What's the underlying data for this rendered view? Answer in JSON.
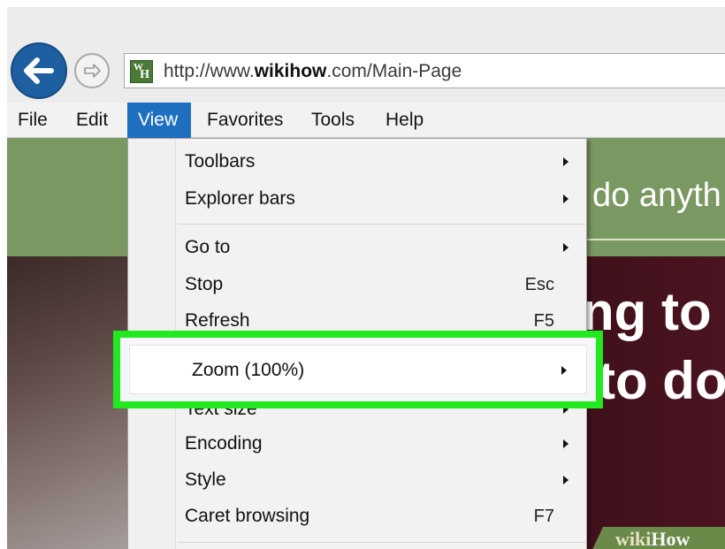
{
  "browser": {
    "url_prefix": "http://www.",
    "url_domain": "wikihow",
    "url_suffix": ".com/Main-Page",
    "favicon_w": "W",
    "favicon_h": "H"
  },
  "menubar": {
    "items": [
      {
        "label": "File"
      },
      {
        "label": "Edit"
      },
      {
        "label": "View"
      },
      {
        "label": "Favorites"
      },
      {
        "label": "Tools"
      },
      {
        "label": "Help"
      }
    ]
  },
  "page": {
    "hero_text": "do anyth",
    "big_text_1": "ng to",
    "big_text_2": "to do",
    "watermark_1": "wiki",
    "watermark_2": "How"
  },
  "view_menu": {
    "items": [
      {
        "label": "Toolbars",
        "submenu": true
      },
      {
        "label": "Explorer bars",
        "submenu": true
      },
      {
        "label": "Go to",
        "submenu": true
      },
      {
        "label": "Stop",
        "shortcut": "Esc"
      },
      {
        "label": "Refresh",
        "shortcut": "F5"
      },
      {
        "label": "Zoom (100%)",
        "submenu": true,
        "highlighted": true
      },
      {
        "label": "Text size",
        "submenu": true
      },
      {
        "label": "Encoding",
        "submenu": true
      },
      {
        "label": "Style",
        "submenu": true
      },
      {
        "label": "Caret browsing",
        "shortcut": "F7"
      }
    ]
  },
  "colors": {
    "highlight_box": "#22e820",
    "menu_active": "#1f6fc0",
    "back_button": "#1d5fa1"
  }
}
